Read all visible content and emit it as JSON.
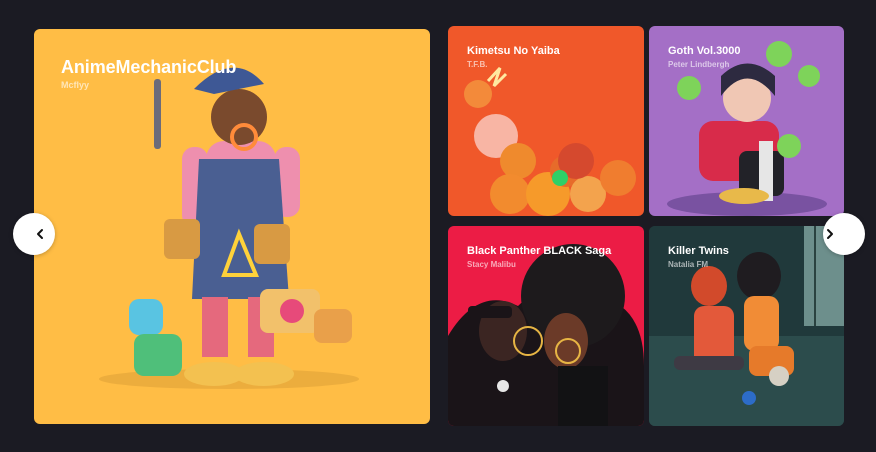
{
  "cards": [
    {
      "title": "AnimeMechanicClub",
      "author": "Mcflyy",
      "bg": "#ffbd45"
    },
    {
      "title": "Kimetsu No Yaiba",
      "author": "T.F.B.",
      "bg": "#f0582a"
    },
    {
      "title": "Goth Vol.3000",
      "author": "Peter Lindbergh",
      "bg": "#a46fc6"
    },
    {
      "title": "Black Panther BLACK Saga",
      "author": "Stacy Malibu",
      "bg": "#ec1c45"
    },
    {
      "title": "Killer Twins",
      "author": "Natalia FM",
      "bg": "#223d3f"
    }
  ],
  "icons": {
    "prev": "chevron-left-icon",
    "next": "chevron-right-icon"
  }
}
